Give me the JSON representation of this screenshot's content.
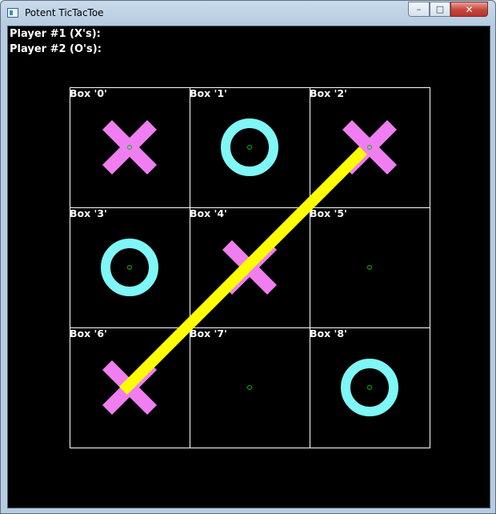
{
  "window": {
    "title": "Potent TicTacToe",
    "icon": "app-window-icon",
    "controls": {
      "minimize": "minimize-icon",
      "maximize": "maximize-icon",
      "close": "close-icon"
    }
  },
  "players": {
    "player1": "Player #1 (X's):",
    "player2": "Player #2 (O's):"
  },
  "board": {
    "boxes": [
      {
        "label": "Box '0'",
        "mark": "X"
      },
      {
        "label": "Box '1'",
        "mark": "O"
      },
      {
        "label": "Box '2'",
        "mark": "X"
      },
      {
        "label": "Box '3'",
        "mark": "O"
      },
      {
        "label": "Box '4'",
        "mark": "X"
      },
      {
        "label": "Box '5'",
        "mark": ""
      },
      {
        "label": "Box '6'",
        "mark": "X"
      },
      {
        "label": "Box '7'",
        "mark": ""
      },
      {
        "label": "Box '8'",
        "mark": "O"
      }
    ],
    "winning_line": [
      6,
      4,
      2
    ],
    "colors": {
      "background": "#000000",
      "grid": "#ffffff",
      "x_mark": "#f07ef0",
      "o_mark": "#7ff7f7",
      "center_dot": "#00c000",
      "win_line": "#ffff00"
    }
  }
}
